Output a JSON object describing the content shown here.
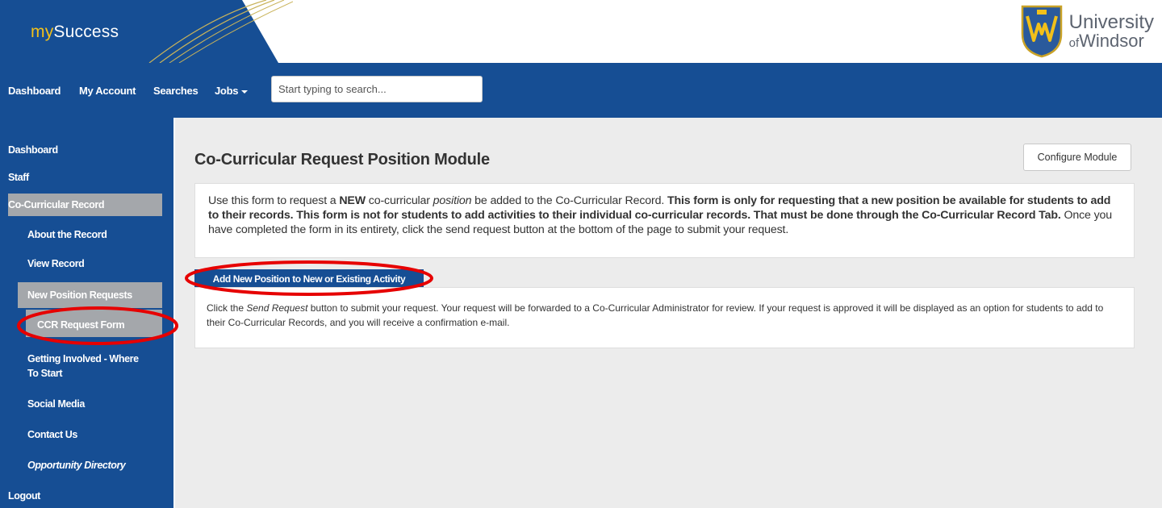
{
  "header": {
    "logo_prefix": "my",
    "logo_suffix": "Success",
    "university_line1": "University",
    "university_of": "of",
    "university_line2": "Windsor"
  },
  "topnav": {
    "dashboard": "Dashboard",
    "my_account": "My Account",
    "searches": "Searches",
    "jobs": "Jobs",
    "search_placeholder": "Start typing to search..."
  },
  "sidebar": {
    "items": [
      "Dashboard",
      "Staff",
      "Co-Curricular Record",
      "About the Record",
      "View Record",
      "New Position Requests",
      "CCR Request Form",
      "Getting Involved - Where",
      "To Start",
      "Social Media",
      "Contact Us",
      "Opportunity Directory",
      "Logout"
    ]
  },
  "main": {
    "title": "Co-Curricular Request Position Module",
    "configure_label": "Configure Module",
    "intro": {
      "t1": "Use this form to request a ",
      "t2": "NEW",
      "t3": " co-curricular ",
      "t4": "position",
      "t5": " be added to the Co-Curricular Record. ",
      "t6": "This form is only for requesting that a new position be available for students to add to their records. This form is not for students to add activities to their individual co-curricular records. That must be done through the Co-Curricular Record Tab.",
      "t7": " Once you have completed the form in its entirety, click the send request button at the bottom of the page to submit your request."
    },
    "add_button": "Add New Position to New or Existing Activity",
    "note": {
      "t1": "Click the ",
      "t2": "Send Request",
      "t3": " button to submit your request. Your request will be forwarded to a Co-Curricular Administrator for review. If your request is approved it will be displayed as an option for students to add to their Co-Curricular Records, and you will receive a confirmation e-mail."
    }
  },
  "colors": {
    "brand_blue": "#164e94",
    "active_gray": "#a4a7ab",
    "annotation_red": "#e60000",
    "logo_yellow": "#f2c01a"
  }
}
